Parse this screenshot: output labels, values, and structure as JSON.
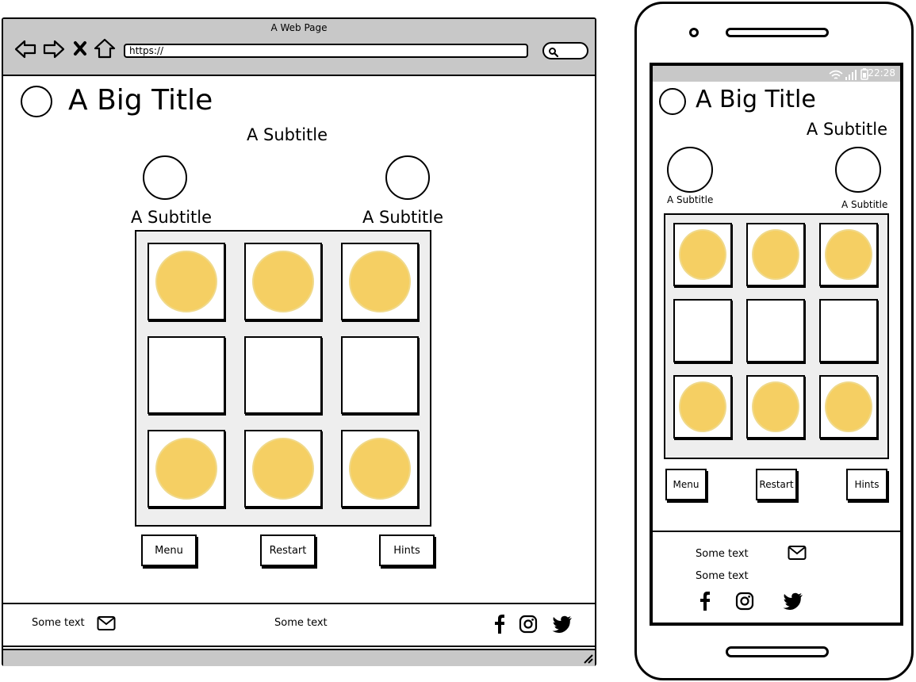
{
  "browser": {
    "window_title": "A Web Page",
    "url": "https://",
    "page_title": "A Big Title",
    "subtitle_main": "A Subtitle",
    "subtitle_left": "A Subtitle",
    "subtitle_right": "A Subtitle",
    "board": [
      [
        "token",
        "token",
        "token"
      ],
      [
        "empty",
        "empty",
        "empty"
      ],
      [
        "token",
        "token",
        "token"
      ]
    ],
    "buttons": {
      "menu": "Menu",
      "restart": "Restart",
      "hints": "Hints"
    },
    "footer": {
      "text_left": "Some text",
      "text_center": "Some text"
    }
  },
  "phone": {
    "status_time": "22:28",
    "page_title": "A Big Title",
    "subtitle_main": "A Subtitle",
    "subtitle_left": "A Subtitle",
    "subtitle_right": "A Subtitle",
    "board": [
      [
        "token",
        "token",
        "token"
      ],
      [
        "empty",
        "empty",
        "empty"
      ],
      [
        "token",
        "token",
        "token"
      ]
    ],
    "buttons": {
      "menu": "Menu",
      "restart": "Restart",
      "hints": "Hints"
    },
    "footer": {
      "text_1": "Some text",
      "text_2": "Some text"
    }
  },
  "colors": {
    "token": "#f5cf63",
    "board_bg": "#eeeeee",
    "chrome": "#c8c8c8"
  },
  "icons": [
    "back-arrow-icon",
    "forward-arrow-icon",
    "close-icon",
    "home-icon",
    "search-icon",
    "mail-icon",
    "facebook-icon",
    "instagram-icon",
    "twitter-icon",
    "wifi-icon",
    "signal-icon",
    "battery-icon"
  ]
}
